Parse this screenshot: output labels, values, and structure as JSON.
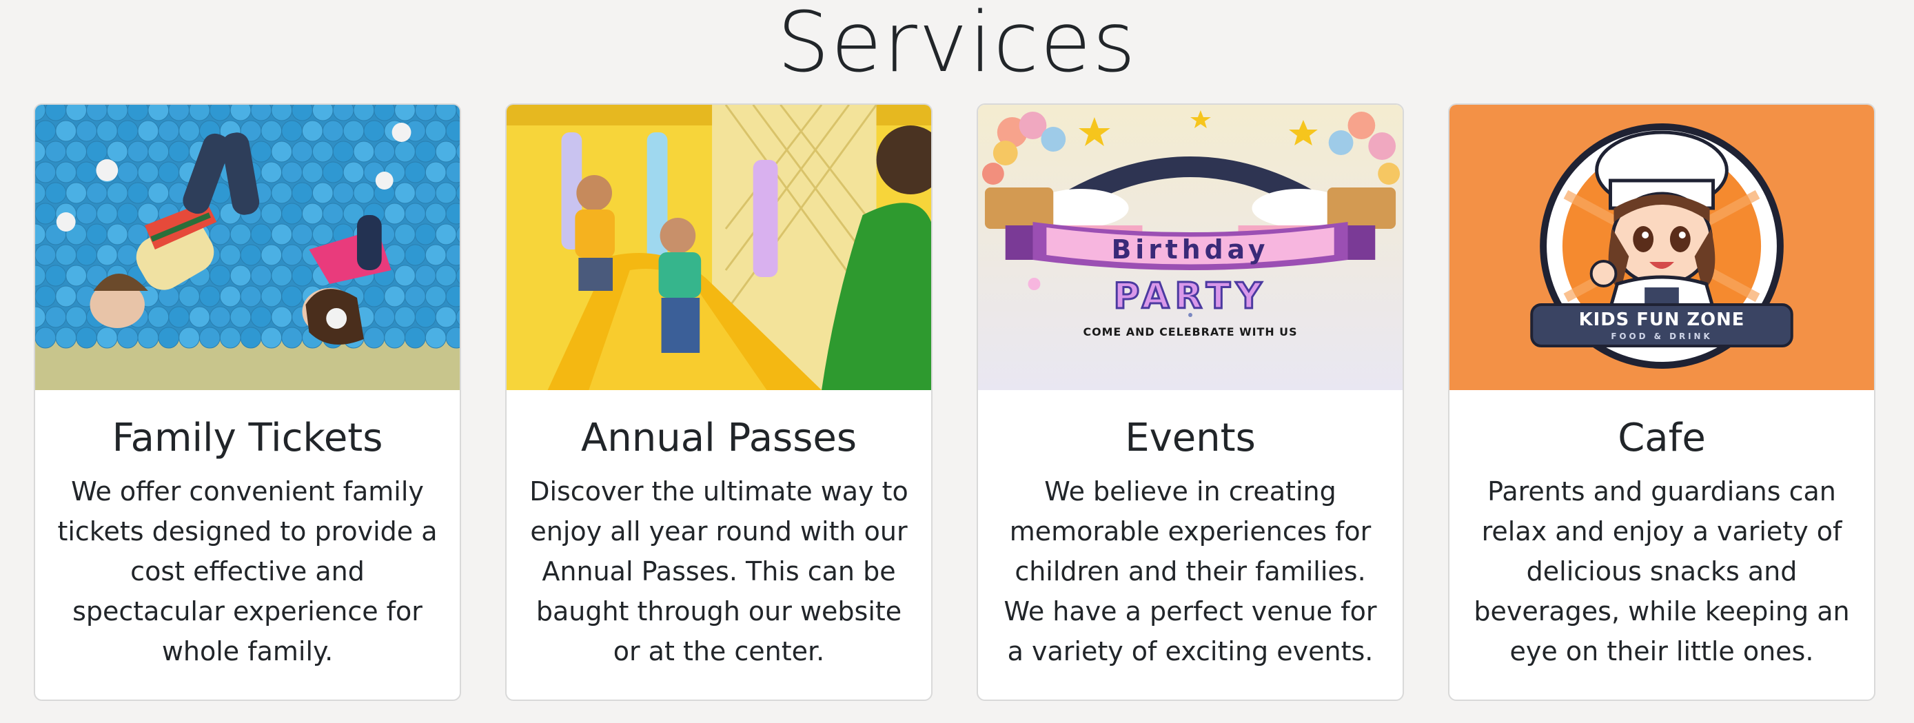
{
  "section": {
    "title": "Services"
  },
  "cards": [
    {
      "title": "Family Tickets",
      "text": "We offer convenient family tickets designed to provide a cost effective and spectacular experience for whole family.",
      "image": "ball-pit-photo"
    },
    {
      "title": "Annual Passes",
      "text": "Discover the ultimate way to enjoy all year round with our Annual Passes. This can be baught through our website or at the center.",
      "image": "slide-photo"
    },
    {
      "title": "Events",
      "text": "We believe in creating memorable experiences for children and their families. We have a perfect venue for a variety of exciting events.",
      "image": "birthday-party-poster",
      "poster": {
        "banner": "Birthday",
        "headline": "PARTY",
        "tagline": "COME AND CELEBRATE WITH US"
      }
    },
    {
      "title": "Cafe",
      "text": "Parents and guardians can relax and enjoy a variety of delicious snacks and beverages, while keeping an eye on their little ones.",
      "image": "cafe-logo",
      "logo": {
        "name": "KIDS FUN ZONE",
        "sub": "FOOD & DRINK"
      }
    }
  ],
  "colors": {
    "background": "#f4f3f2",
    "cafe_orange": "#f39146",
    "ball_blue": "#3fa6dc",
    "slide_yellow": "#f5c316",
    "banner_purple": "#9b4fb3",
    "logo_navy": "#3a4463"
  }
}
